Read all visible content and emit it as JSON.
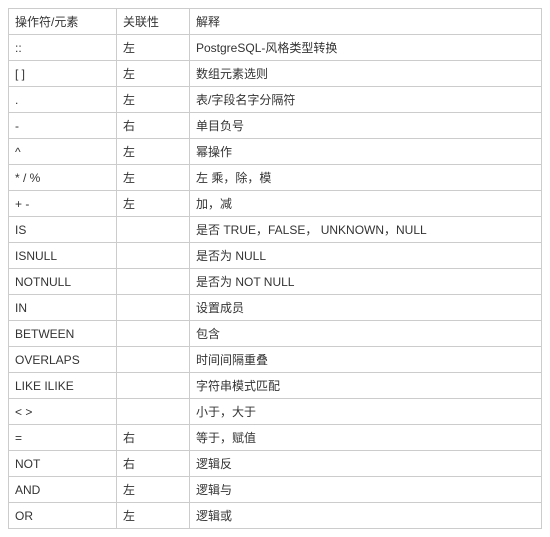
{
  "headers": {
    "operator": "操作符/元素",
    "associativity": "关联性",
    "description": "解释"
  },
  "rows": [
    {
      "op": "::",
      "assoc": "左",
      "desc": "PostgreSQL-风格类型转换"
    },
    {
      "op": "[ ]",
      "assoc": "左",
      "desc": "数组元素选则"
    },
    {
      "op": ".",
      "assoc": "左",
      "desc": "表/字段名字分隔符"
    },
    {
      "op": "-",
      "assoc": "右",
      "desc": "单目负号"
    },
    {
      "op": "^",
      "assoc": "左",
      "desc": "幂操作"
    },
    {
      "op": "* / %",
      "assoc": "左",
      "desc": "左 乘，除，模"
    },
    {
      "op": "+ -",
      "assoc": "左",
      "desc": "加，减"
    },
    {
      "op": "IS",
      "assoc": "",
      "desc": "是否 TRUE，FALSE，  UNKNOWN，NULL"
    },
    {
      "op": "ISNULL",
      "assoc": "",
      "desc": "是否为 NULL"
    },
    {
      "op": "NOTNULL",
      "assoc": "",
      "desc": "是否为 NOT NULL"
    },
    {
      "op": "IN",
      "assoc": "",
      "desc": "设置成员"
    },
    {
      "op": "BETWEEN",
      "assoc": "",
      "desc": "包含"
    },
    {
      "op": "OVERLAPS",
      "assoc": "",
      "desc": "时间间隔重叠"
    },
    {
      "op": "LIKE ILIKE",
      "assoc": "",
      "desc": "字符串模式匹配"
    },
    {
      "op": "< >",
      "assoc": "",
      "desc": "小于，大于"
    },
    {
      "op": "=",
      "assoc": "右",
      "desc": "等于，赋值"
    },
    {
      "op": "NOT",
      "assoc": "右",
      "desc": "逻辑反"
    },
    {
      "op": "AND",
      "assoc": "左",
      "desc": "逻辑与"
    },
    {
      "op": "OR",
      "assoc": "左",
      "desc": "逻辑或"
    }
  ]
}
